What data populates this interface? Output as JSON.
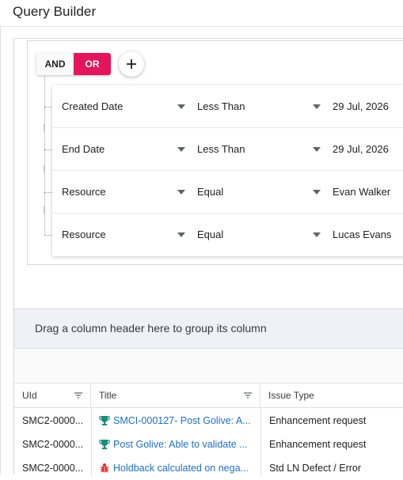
{
  "window": {
    "title": "Query Builder"
  },
  "query_builder": {
    "group": {
      "and_label": "AND",
      "or_label": "OR",
      "active": "OR"
    },
    "add_button_icon": "plus-icon",
    "rules": [
      {
        "field": "Created Date",
        "operator": "Less Than",
        "value": "29 Jul, 2026"
      },
      {
        "field": "End Date",
        "operator": "Less Than",
        "value": "29 Jul, 2026"
      },
      {
        "field": "Resource",
        "operator": "Equal",
        "value": "Evan Walker"
      },
      {
        "field": "Resource",
        "operator": "Equal",
        "value": "Lucas Evans"
      }
    ]
  },
  "grid": {
    "group_drop_text": "Drag a column header here to group its column",
    "columns": [
      {
        "label": "UId",
        "filter_icon": "filter-icon"
      },
      {
        "label": "Title",
        "filter_icon": "filter-icon"
      },
      {
        "label": "Issue Type"
      }
    ],
    "rows": [
      {
        "uid": "SMC2-0000...",
        "icon": "trophy-icon",
        "icon_color": "#1b8a7a",
        "title": "SMCI-000127- Post Golive: A...",
        "issue_type": "Enhancement request"
      },
      {
        "uid": "SMC2-0000...",
        "icon": "trophy-icon",
        "icon_color": "#1b8a7a",
        "title": "Post Golive: Able to validate ...",
        "issue_type": "Enhancement request"
      },
      {
        "uid": "SMC2-0000...",
        "icon": "bug-icon",
        "icon_color": "#e02b2b",
        "title": "Holdback calculated on nega...",
        "issue_type": "Std LN Defect / Error"
      }
    ]
  },
  "colors": {
    "accent": "#e3165b",
    "link": "#1e6fc0",
    "group_bar": "#eef1f8"
  }
}
